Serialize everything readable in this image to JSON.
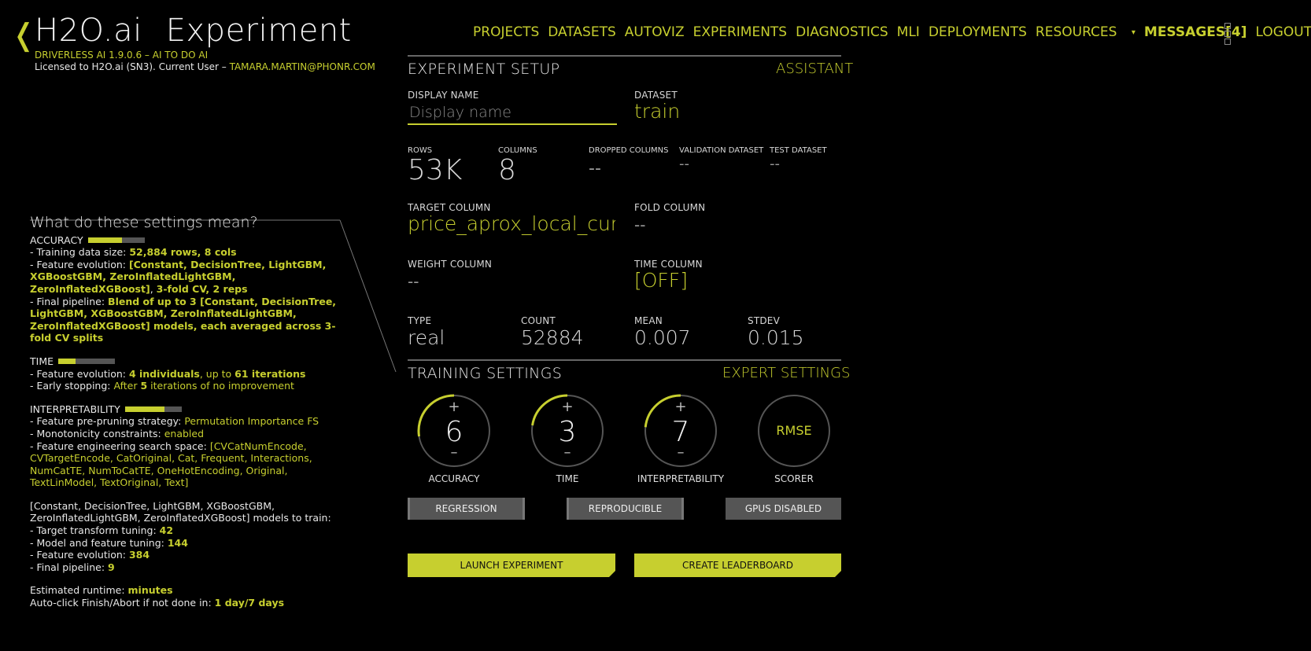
{
  "header": {
    "back_glyph": "❬",
    "brand": "H2O.ai",
    "page": "Experiment",
    "version": "DRIVERLESS AI 1.9.0.6 – AI TO DO AI",
    "license_prefix": "Licensed to H2O.ai (SN3). Current User – ",
    "user": "TAMARA.MARTIN@PHONR.COM"
  },
  "nav": {
    "projects": "PROJECTS",
    "datasets": "DATASETS",
    "autoviz": "AUTOVIZ",
    "experiments": "EXPERIMENTS",
    "diagnostics": "DIAGNOSTICS",
    "mli": "MLI",
    "deployments": "DEPLOYMENTS",
    "resources": "RESOURCES",
    "resources_caret": "▾",
    "messages": "MESSAGES[4]",
    "logout": "LOGOUT"
  },
  "explain": {
    "title": "What do these settings mean?",
    "accuracy": {
      "head": "ACCURACY",
      "level": 0.6,
      "l1_prefix": "- Training data size: ",
      "l1_value": "52,884 rows, 8 cols",
      "l2_prefix": "- Feature evolution: ",
      "l2_value": "[Constant, DecisionTree, LightGBM, XGBoostGBM, ZeroInflatedLightGBM, ZeroInflatedXGBoost]",
      "l2_sep": ",",
      "l2_tail": "3-fold CV, 2 reps",
      "l3_prefix": "- Final pipeline: ",
      "l3_value": "Blend of up to 3 [Constant, DecisionTree, LightGBM, XGBoostGBM, ZeroInflatedLightGBM, ZeroInflatedXGBoost] models, each averaged across 3-fold CV splits"
    },
    "time": {
      "head": "TIME",
      "level": 0.3,
      "l1_prefix": "- Feature evolution: ",
      "l1_a": "4 individuals",
      "l1_b": ", up to ",
      "l1_c": "61 iterations",
      "l2_prefix": "- Early stopping: ",
      "l2_a": "After ",
      "l2_b": "5",
      "l2_c": " iterations of no improvement"
    },
    "interpretability": {
      "head": "INTERPRETABILITY",
      "level": 0.7,
      "l1_prefix": "- Feature pre-pruning strategy: ",
      "l1_value": "Permutation Importance FS",
      "l2_prefix": "- Monotonicity constraints: ",
      "l2_value": "enabled",
      "l3_prefix": "- Feature engineering search space: ",
      "l3_value": "[CVCatNumEncode, CVTargetEncode, CatOriginal, Cat, Frequent, Interactions, NumCatTE, NumToCatTE, OneHotEncoding, Original, TextLinModel, TextOriginal, Text]"
    },
    "models": {
      "intro": "[Constant, DecisionTree, LightGBM, XGBoostGBM, ZeroInflatedLightGBM, ZeroInflatedXGBoost] models to train:",
      "l1_prefix": "- Target transform tuning: ",
      "l1_value": "42",
      "l2_prefix": "- Model and feature tuning: ",
      "l2_value": "144",
      "l3_prefix": "- Feature evolution: ",
      "l3_value": "384",
      "l4_prefix": "- Final pipeline: ",
      "l4_value": "9"
    },
    "runtime": {
      "l1_prefix": "Estimated runtime: ",
      "l1_value": "minutes",
      "l2_prefix": "Auto-click Finish/Abort if not done in: ",
      "l2_value": "1 day/7 days"
    }
  },
  "setup": {
    "title": "EXPERIMENT SETUP",
    "assistant": "ASSISTANT",
    "display_name_label": "DISPLAY NAME",
    "display_name_placeholder": "Display name",
    "dataset_label": "DATASET",
    "dataset_value": "train",
    "rows_label": "ROWS",
    "rows_value": "53K",
    "columns_label": "COLUMNS",
    "columns_value": "8",
    "dropped_label": "DROPPED COLUMNS",
    "dropped_value": "--",
    "validation_label": "VALIDATION DATASET",
    "validation_value": "--",
    "test_label": "TEST DATASET",
    "test_value": "--",
    "target_label": "TARGET COLUMN",
    "target_value": "price_aprox_local_curren",
    "fold_label": "FOLD COLUMN",
    "fold_value": "--",
    "weight_label": "WEIGHT COLUMN",
    "weight_value": "--",
    "time_col_label": "TIME COLUMN",
    "time_col_value": "[OFF]",
    "type_label": "TYPE",
    "type_value": "real",
    "count_label": "COUNT",
    "count_value": "52884",
    "mean_label": "MEAN",
    "mean_value": "0.007",
    "stdev_label": "STDEV",
    "stdev_value": "0.015"
  },
  "training": {
    "title": "TRAINING SETTINGS",
    "expert": "EXPERT SETTINGS",
    "plus": "+",
    "minus": "–",
    "accuracy_value": "6",
    "accuracy_label": "ACCURACY",
    "accuracy_fraction": 0.6,
    "time_value": "3",
    "time_label": "TIME",
    "time_fraction": 0.3,
    "interp_value": "7",
    "interp_label": "INTERPRETABILITY",
    "interp_fraction": 0.7,
    "scorer_value": "RMSE",
    "scorer_label": "SCORER",
    "btn_regression": "REGRESSION",
    "btn_reproducible": "REPRODUCIBLE",
    "btn_gpus": "GPUS DISABLED",
    "btn_launch": "LAUNCH EXPERIMENT",
    "btn_leaderboard": "CREATE LEADERBOARD"
  },
  "colors": {
    "accent": "#c7cf2f",
    "background": "#000000",
    "dial_track": "#555555"
  }
}
